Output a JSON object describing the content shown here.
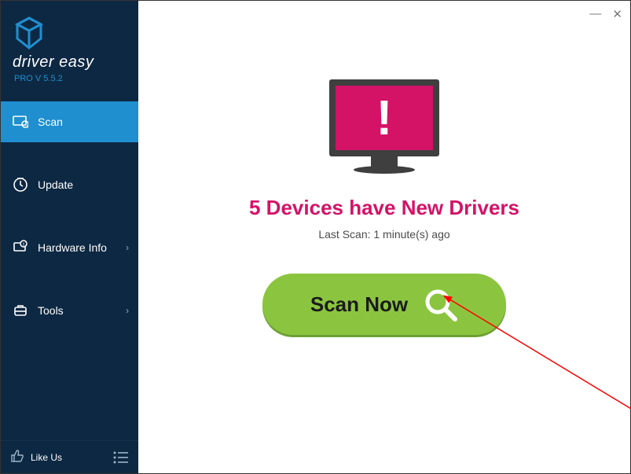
{
  "app": {
    "name": "driver easy",
    "version": "PRO V 5.5.2"
  },
  "sidebar": {
    "items": [
      {
        "label": "Scan",
        "icon": "scan-icon",
        "active": true
      },
      {
        "label": "Update",
        "icon": "update-icon",
        "chevron": false
      },
      {
        "label": "Hardware Info",
        "icon": "hardware-icon",
        "chevron": true
      },
      {
        "label": "Tools",
        "icon": "tools-icon",
        "chevron": true
      }
    ],
    "like_us": "Like Us"
  },
  "main": {
    "headline": "5 Devices have New Drivers",
    "subline": "Last Scan: 1 minute(s) ago",
    "scan_button": "Scan Now"
  },
  "colors": {
    "sidebar_bg": "#0d2842",
    "accent": "#1f8fcf",
    "alert": "#d41367",
    "action": "#8bc53f"
  }
}
